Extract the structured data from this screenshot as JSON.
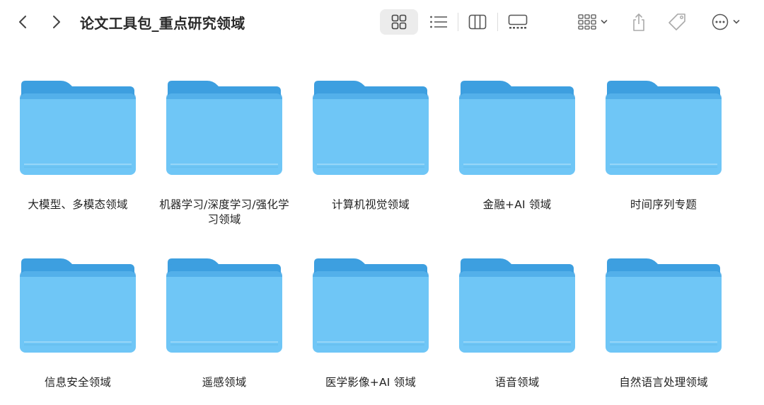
{
  "window": {
    "title": "论文工具包_重点研究领域"
  },
  "toolbar": {
    "back_icon": "chevron-left-icon",
    "forward_icon": "chevron-right-icon",
    "views": [
      {
        "name": "icon-view",
        "icon": "grid-icon",
        "active": true
      },
      {
        "name": "list-view",
        "icon": "list-icon",
        "active": false
      },
      {
        "name": "column-view",
        "icon": "columns-icon",
        "active": false
      },
      {
        "name": "gallery-view",
        "icon": "gallery-icon",
        "active": false
      }
    ],
    "group_icon": "group-icon",
    "share_icon": "share-icon",
    "tag_icon": "tag-icon",
    "more_icon": "ellipsis-icon"
  },
  "colors": {
    "folder_front": "#6fc6f6",
    "folder_back": "#3d9fe0",
    "folder_tab": "#4aa9e8"
  },
  "folders": [
    {
      "label": "大模型、多模态领域"
    },
    {
      "label": "机器学习/深度学习/强化学习领域"
    },
    {
      "label": "计算机视觉领域"
    },
    {
      "label": "金融+AI 领域"
    },
    {
      "label": "时间序列专题"
    },
    {
      "label": "信息安全领域"
    },
    {
      "label": "遥感领域"
    },
    {
      "label": "医学影像+AI 领域"
    },
    {
      "label": "语音领域"
    },
    {
      "label": "自然语言处理领域"
    }
  ]
}
